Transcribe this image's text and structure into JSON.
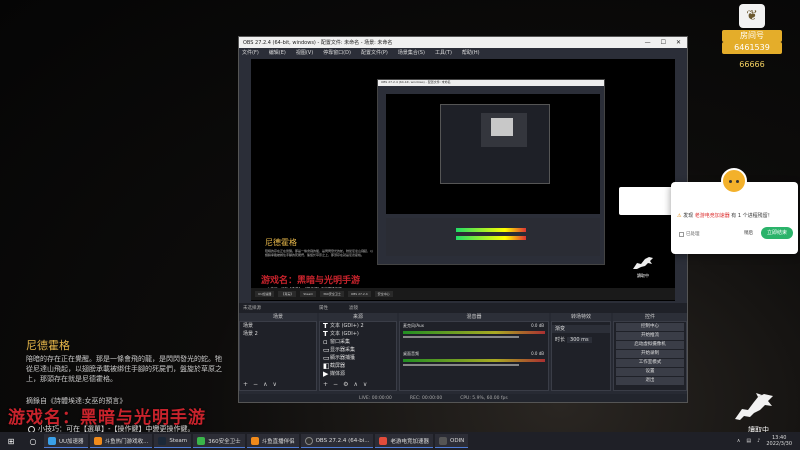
{
  "badge": {
    "tag1": "房间号",
    "tag2": "6461539",
    "fans": "66666"
  },
  "obs": {
    "title": "OBS 27.2.4 (64-bit, windows) - 配置文件: 未命名 - 场景: 未命名",
    "menu": [
      "文件(F)",
      "编辑(E)",
      "视图(V)",
      "停靠窗口(D)",
      "配置文件(P)",
      "场景集合(S)",
      "工具(T)",
      "帮助(H)"
    ],
    "preview": {
      "nested_title": "OBS 27.2.4 (64-bit, windows) - 配置文件: 未命名",
      "side_title": "尼德霍格",
      "side_text": "陪暗的存在正在覺醒。那是一條會飛的龍，是閃閃發光的蛇。牠從尼達山飛起，以翅膀承載被綁住手腳的死屍們，盤旋於草原之上，那頭存在就是尼德霍格。",
      "red_text": "游戏名：黑暗与光明手游",
      "tip": "小技巧：可在【选单】-【操作键】中變更操作鍵。",
      "read": "讀取中",
      "taskbar": [
        "UU加速器",
        "【真実】",
        "Steam",
        "360安全卫士",
        "OBS 27.2.4",
        "安全中心"
      ]
    },
    "no_source": "未选择源",
    "props_label": "属性",
    "filters_label": "滤镜",
    "docks": {
      "scenes_header": "场景",
      "scenes": [
        "场景",
        "场景 2"
      ],
      "sources_header": "来源",
      "sources": [
        "文本 (GDI+) 2",
        "文本 (GDI+)",
        "窗口采集",
        "显示器采集",
        "顯示器捕獲",
        "截屏器",
        "媒体源"
      ],
      "mixer_header": "混音器",
      "mixer": [
        {
          "name": "麦克风/Aux",
          "db": "0.0 dB"
        },
        {
          "name": "桌面音频",
          "db": "0.0 dB"
        }
      ],
      "transitions_header": "转场特效",
      "transition": "渐变",
      "duration_label": "时长",
      "duration": "300 ms",
      "controls_header": "控件",
      "controls": [
        "控制中心",
        "开始推流",
        "启动虚拟摄像机",
        "开始录制",
        "工作室模式",
        "设置",
        "退出"
      ]
    },
    "status": {
      "live": "LIVE: 00:00:00",
      "rec": "REC: 00:00:00",
      "cpu": "CPU: 5.9%, 60.00 fps"
    }
  },
  "popup": {
    "msg_prefix": "发现",
    "msg_link": "老游电竞加速器",
    "msg_suffix": "有 1 个进程残留！",
    "check": "已处理",
    "later": "稍后",
    "stop": "立即结束"
  },
  "overlay": {
    "title": "尼德霍格",
    "text": "陪暗的存在正在覺醒。那是一條會飛的龍，是閃閃發光的蛇。牠從尼達山飛起，以翅膀承載被綁住手腳的死屍們，盤旋於草原之上，那頭存在就是尼德霍格。",
    "source": "摘錄自《詩體埃達:女巫的預言》",
    "game": "游戏名：黑暗与光明手游",
    "tip": "小技巧：可在【選單】-【操作鍵】中變更操作鍵。",
    "read": "讀取中"
  },
  "taskbar": {
    "items": [
      {
        "label": "UU加速器",
        "color": "#3aa0e8"
      },
      {
        "label": "斗鱼热门游戏收...",
        "color": "#f08a1b"
      },
      {
        "label": "Steam",
        "color": "#1b2838"
      },
      {
        "label": "360安全卫士",
        "color": "#3ab54a"
      },
      {
        "label": "斗鱼直播伴侣",
        "color": "#f08a1b"
      },
      {
        "label": "OBS 27.2.4 (64-bi...",
        "color": "#303030"
      },
      {
        "label": "老游电竞加速器",
        "color": "#e24c3b"
      },
      {
        "label": "ODIN",
        "color": "#555"
      }
    ],
    "time": "13:40",
    "date": "2022/3/30"
  },
  "colors": {
    "accent": "#e8b84a",
    "red": "#c8232c",
    "green": "#2bb36a"
  }
}
